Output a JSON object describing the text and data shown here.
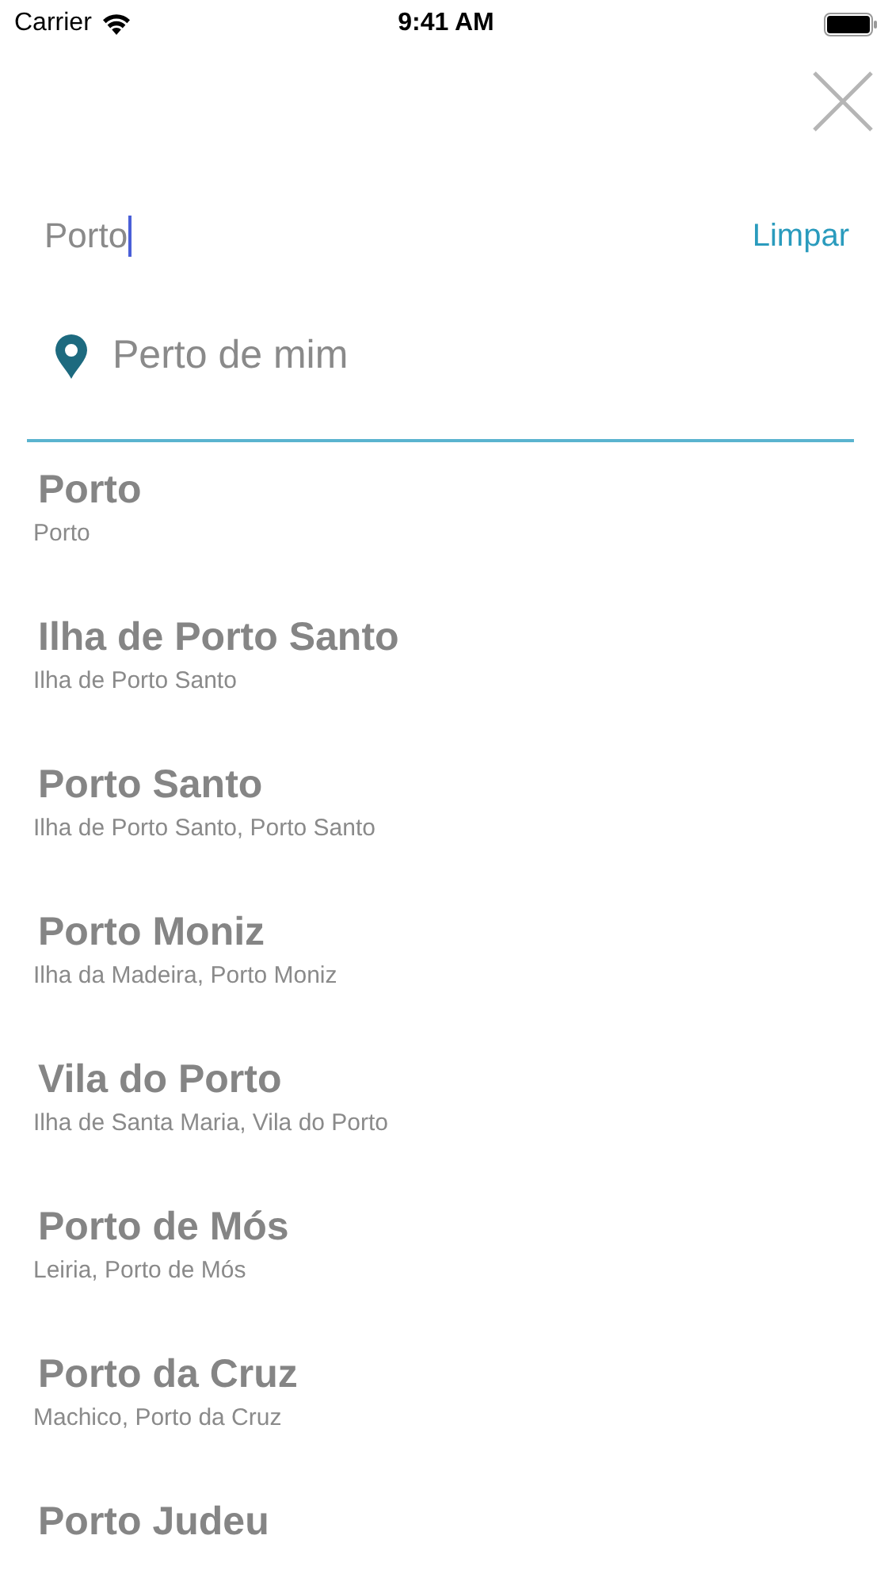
{
  "status_bar": {
    "carrier": "Carrier",
    "time": "9:41 AM"
  },
  "search": {
    "value": "Porto",
    "clear_label": "Limpar"
  },
  "nearby": {
    "label": "Perto de mim"
  },
  "results": [
    {
      "title": "Porto",
      "subtitle": "Porto"
    },
    {
      "title": "Ilha de Porto Santo",
      "subtitle": "Ilha de Porto Santo"
    },
    {
      "title": "Porto Santo",
      "subtitle": "Ilha de Porto Santo, Porto Santo"
    },
    {
      "title": "Porto Moniz",
      "subtitle": "Ilha da Madeira, Porto Moniz"
    },
    {
      "title": "Vila do Porto",
      "subtitle": "Ilha de Santa Maria, Vila do Porto"
    },
    {
      "title": "Porto de Mós",
      "subtitle": "Leiria, Porto de Mós"
    },
    {
      "title": "Porto da Cruz",
      "subtitle": "Machico, Porto da Cruz"
    },
    {
      "title": "Porto Judeu"
    }
  ]
}
